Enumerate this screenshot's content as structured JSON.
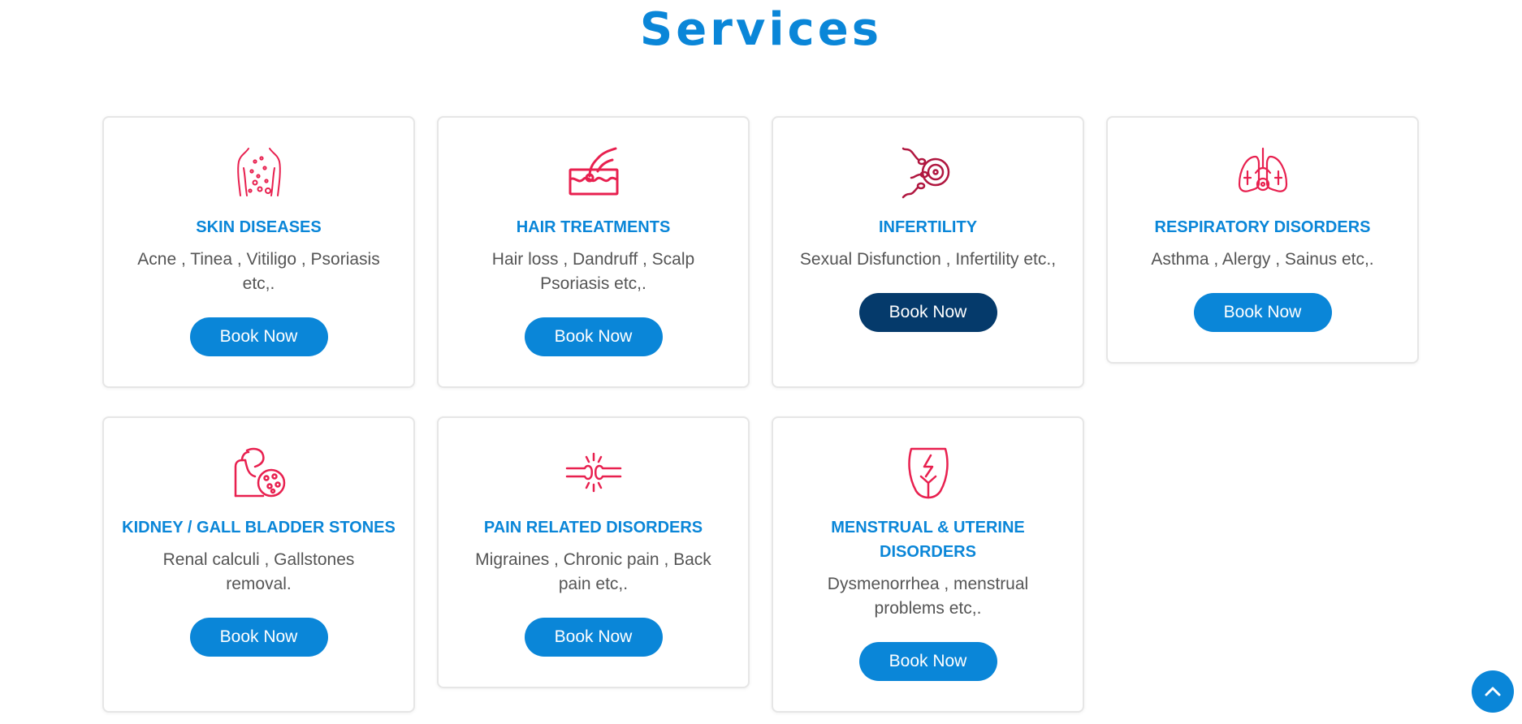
{
  "section": {
    "title": "Services"
  },
  "colors": {
    "accent": "#0a86d8",
    "accent_dark": "#053a6b",
    "icon_red": "#e8204f",
    "text_gray": "#555555"
  },
  "services": [
    {
      "icon": "skin-icon",
      "title": "SKIN DISEASES",
      "description": "Acne , Tinea , Vitiligo , Psoriasis etc,.",
      "button": "Book Now"
    },
    {
      "icon": "hair-follicle-icon",
      "title": "HAIR TREATMENTS",
      "description": "Hair loss , Dandruff , Scalp Psoriasis etc,.",
      "button": "Book Now"
    },
    {
      "icon": "sperm-egg-icon",
      "title": "INFERTILITY",
      "description": "Sexual Disfunction , Infertility etc.,",
      "button": "Book Now"
    },
    {
      "icon": "lungs-icon",
      "title": "RESPIRATORY DISORDERS",
      "description": "Asthma , Alergy , Sainus etc,.",
      "button": "Book Now"
    },
    {
      "icon": "kidney-stones-icon",
      "title": "KIDNEY / GALL BLADDER STONES",
      "description": "Renal calculi , Gallstones removal.",
      "button": "Book Now"
    },
    {
      "icon": "joint-pain-icon",
      "title": "PAIN RELATED DISORDERS",
      "description": "Migraines , Chronic pain , Back pain etc,.",
      "button": "Book Now"
    },
    {
      "icon": "uterus-icon",
      "title": "MENSTRUAL & UTERINE DISORDERS",
      "description": "Dysmenorrhea , menstrual problems etc,.",
      "button": "Book Now"
    }
  ],
  "scroll_top": {
    "icon": "chevron-up-icon"
  }
}
